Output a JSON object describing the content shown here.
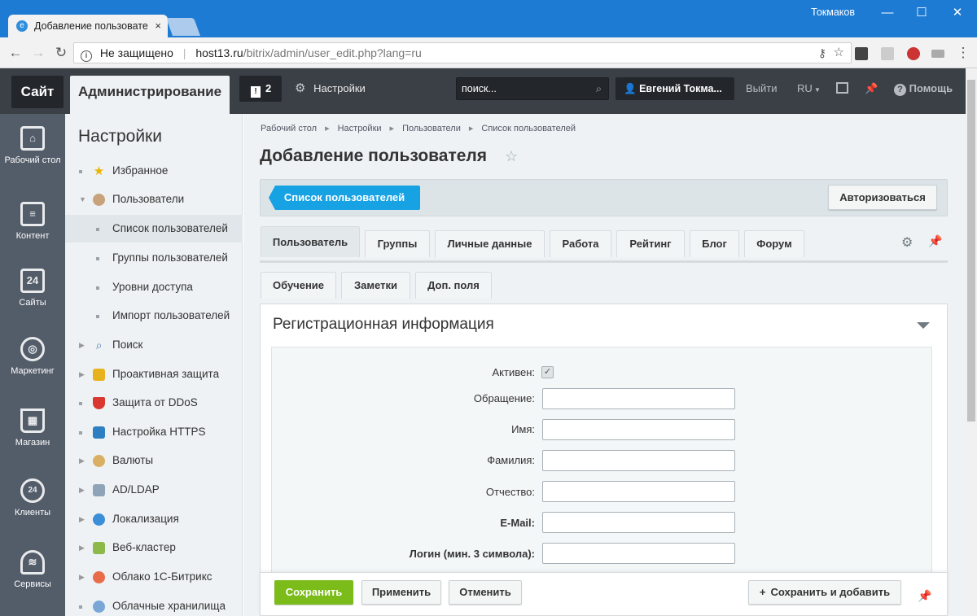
{
  "browser": {
    "tab_title": "Добавление пользовате",
    "tab_close": "×",
    "window_user": "Токмаков",
    "url_security": "Не защищено",
    "url_host": "host13.ru",
    "url_path": "/bitrix/admin/user_edit.php?lang=ru",
    "controls": {
      "minimize": "—",
      "maximize": "☐",
      "close": "✕"
    }
  },
  "topbar": {
    "site": "Сайт",
    "admin": "Администрирование",
    "notifications_count": "2",
    "settings": "Настройки",
    "search_placeholder": "поиск...",
    "user": "Евгений Токма...",
    "logout": "Выйти",
    "lang": "RU",
    "help": "Помощь"
  },
  "leftbar": [
    {
      "label": "Рабочий стол",
      "icon": "home-icon"
    },
    {
      "label": "Контент",
      "icon": "content-icon"
    },
    {
      "label": "Сайты",
      "icon": "calendar-24-icon"
    },
    {
      "label": "Маркетинг",
      "icon": "target-icon"
    },
    {
      "label": "Магазин",
      "icon": "basket-icon"
    },
    {
      "label": "Клиенты",
      "icon": "clients-24-icon"
    },
    {
      "label": "Сервисы",
      "icon": "layers-icon"
    }
  ],
  "tree": {
    "title": "Настройки",
    "items": [
      {
        "label": "Избранное"
      },
      {
        "label": "Пользователи"
      },
      {
        "label": "Список пользователей"
      },
      {
        "label": "Группы пользователей"
      },
      {
        "label": "Уровни доступа"
      },
      {
        "label": "Импорт пользователей"
      },
      {
        "label": "Поиск"
      },
      {
        "label": "Проактивная защита"
      },
      {
        "label": "Защита от DDoS"
      },
      {
        "label": "Настройка HTTPS"
      },
      {
        "label": "Валюты"
      },
      {
        "label": "AD/LDAP"
      },
      {
        "label": "Локализация"
      },
      {
        "label": "Веб-кластер"
      },
      {
        "label": "Облако 1С-Битрикс"
      },
      {
        "label": "Облачные хранилища"
      }
    ]
  },
  "breadcrumb": [
    "Рабочий стол",
    "Настройки",
    "Пользователи",
    "Список пользователей"
  ],
  "page_title": "Добавление пользователя",
  "context": {
    "list_button": "Список пользователей",
    "authorize_button": "Авторизоваться"
  },
  "tabs_row1": [
    "Пользователь",
    "Группы",
    "Личные данные",
    "Работа",
    "Рейтинг",
    "Блог",
    "Форум"
  ],
  "tabs_row2": [
    "Обучение",
    "Заметки",
    "Доп. поля"
  ],
  "section_title": "Регистрационная информация",
  "form": {
    "active_label": "Активен:",
    "active_checked": true,
    "fields": [
      {
        "label": "Обращение:",
        "value": ""
      },
      {
        "label": "Имя:",
        "value": ""
      },
      {
        "label": "Фамилия:",
        "value": ""
      },
      {
        "label": "Отчество:",
        "value": ""
      },
      {
        "label": "E-Mail:",
        "value": ""
      },
      {
        "label": "Логин (мин. 3 символа):",
        "value": ""
      }
    ]
  },
  "footer": {
    "save": "Сохранить",
    "apply": "Применить",
    "cancel": "Отменить",
    "save_add": "Сохранить и добавить"
  },
  "colors": {
    "accent_blue": "#17a2e4",
    "save_green": "#7bbb1a",
    "panel_dark": "#3b4047",
    "leftbar": "#535c69"
  }
}
